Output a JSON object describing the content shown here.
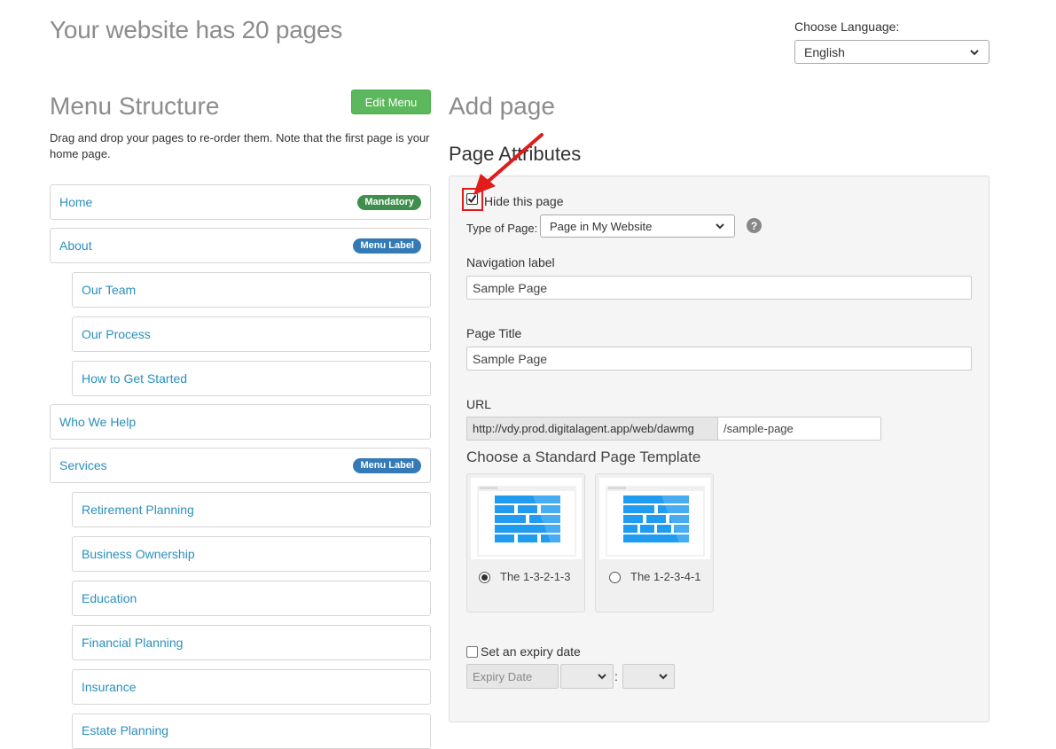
{
  "header": {
    "title": "Your website has 20 pages",
    "language_label": "Choose Language:",
    "language_value": "English"
  },
  "menu": {
    "title": "Menu Structure",
    "edit_button": "Edit Menu",
    "description": "Drag and drop your pages to re-order them. Note that the first page is your home page.",
    "items": [
      {
        "label": "Home",
        "badge": "Mandatory"
      },
      {
        "label": "About",
        "badge": "Menu Label"
      },
      {
        "label": "Our Team"
      },
      {
        "label": "Our Process"
      },
      {
        "label": "How to Get Started"
      },
      {
        "label": "Who We Help"
      },
      {
        "label": "Services",
        "badge": "Menu Label"
      },
      {
        "label": "Retirement Planning"
      },
      {
        "label": "Business Ownership"
      },
      {
        "label": "Education"
      },
      {
        "label": "Financial Planning"
      },
      {
        "label": "Insurance"
      },
      {
        "label": "Estate Planning"
      }
    ]
  },
  "add_page": {
    "title": "Add page",
    "attributes_title": "Page Attributes",
    "hide_label": "Hide this page",
    "hide_checked": true,
    "type_label": "Type of Page:",
    "type_value": "Page in My Website",
    "help_icon": "question-circle-icon",
    "nav_label": "Navigation label",
    "nav_value": "Sample Page",
    "title_label": "Page Title",
    "title_value": "Sample Page",
    "url_label": "URL",
    "url_prefix": "http://vdy.prod.digitalagent.app/web/dawmg",
    "url_slug": "/sample-page",
    "template_title": "Choose a Standard Page Template",
    "templates": [
      {
        "name": "The 1-3-2-1-3",
        "selected": true
      },
      {
        "name": "The 1-2-3-4-1",
        "selected": false
      }
    ],
    "expiry_label": "Set an expiry date",
    "expiry_checked": false,
    "expiry_placeholder": "Expiry Date",
    "time_separator": ":"
  },
  "colors": {
    "link": "#2a8fbd",
    "edit_button": "#5cb85c",
    "badge_mandatory": "#3f8e4c",
    "badge_menu_label": "#337ab7",
    "annotation_red": "#e21b1b",
    "template_blue": "#1f9cf0"
  }
}
